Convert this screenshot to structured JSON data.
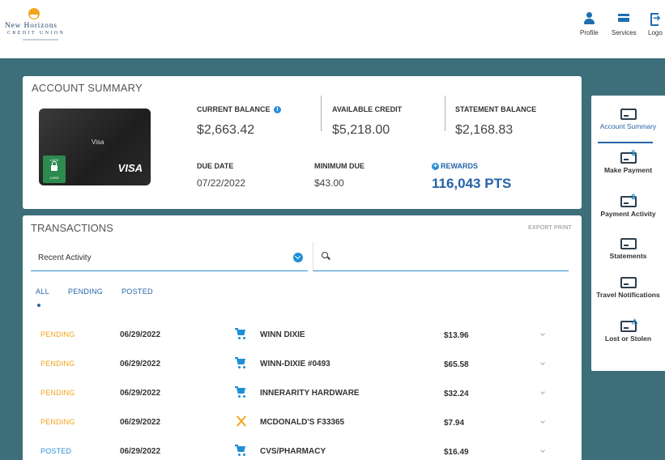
{
  "header": {
    "brand_line1": "New Horizons",
    "brand_line2": "CREDIT UNION",
    "nav": [
      {
        "label": "Profile",
        "icon": "profile-icon"
      },
      {
        "label": "Services",
        "icon": "services-icon"
      },
      {
        "label": "Logo",
        "icon": "logout-icon"
      }
    ]
  },
  "summary": {
    "title": "ACCOUNT SUMMARY",
    "card": {
      "brand_small": "Visa",
      "brand": "VISA",
      "lock_top": "LOCK",
      "lock_bottom": "CARD"
    },
    "current_balance": {
      "label": "CURRENT BALANCE",
      "value": "$2,663.42"
    },
    "available_credit": {
      "label": "AVAILABLE CREDIT",
      "value": "$5,218.00"
    },
    "statement_balance": {
      "label": "STATEMENT BALANCE",
      "value": "$2,168.83"
    },
    "due_date": {
      "label": "DUE DATE",
      "value": "07/22/2022"
    },
    "minimum_due": {
      "label": "MINIMUM DUE",
      "value": "$43.00"
    },
    "rewards": {
      "label": "REWARDS",
      "value": "116,043 PTS"
    }
  },
  "transactions": {
    "title": "TRANSACTIONS",
    "export_print": "EXPORT  PRINT",
    "filter_select": "Recent Activity",
    "tabs": [
      "ALL",
      "PENDING",
      "POSTED"
    ],
    "rows": [
      {
        "status": "PENDING",
        "date": "06/29/2022",
        "category_icon": "cart-icon",
        "merchant": "WINN DIXIE",
        "amount": "$13.96"
      },
      {
        "status": "PENDING",
        "date": "06/29/2022",
        "category_icon": "cart-icon",
        "merchant": "WINN-DIXIE #0493",
        "amount": "$65.58"
      },
      {
        "status": "PENDING",
        "date": "06/29/2022",
        "category_icon": "cart-icon",
        "merchant": "INNERARITY HARDWARE",
        "amount": "$32.24"
      },
      {
        "status": "PENDING",
        "date": "06/29/2022",
        "category_icon": "dining-icon",
        "merchant": "MCDONALD'S F33365",
        "amount": "$7.94"
      },
      {
        "status": "POSTED",
        "date": "06/29/2022",
        "category_icon": "cart-icon",
        "merchant": "CVS/PHARMACY",
        "amount": "$16.49"
      }
    ]
  },
  "sidenav": {
    "items": [
      {
        "label": "Account Summary",
        "badge": ""
      },
      {
        "label": "Make Payment",
        "badge": "$"
      },
      {
        "label": "Payment Activity",
        "badge": "$"
      },
      {
        "label": "Statements",
        "badge": ""
      },
      {
        "label": "Travel Notifications",
        "badge": ""
      },
      {
        "label": "Lost or Stolen",
        "badge": "⚠"
      }
    ]
  }
}
